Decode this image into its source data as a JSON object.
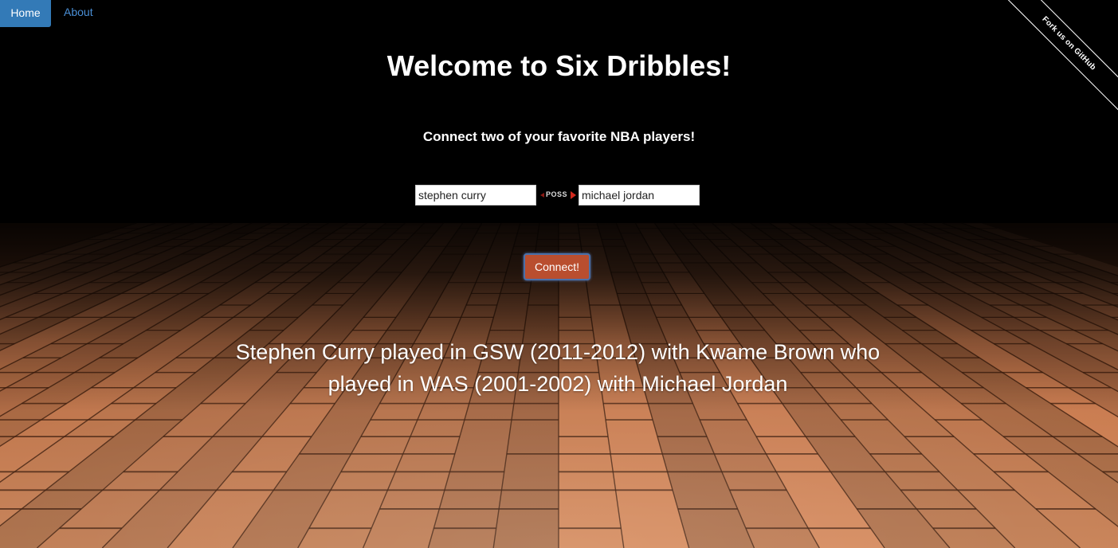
{
  "nav": {
    "home_label": "Home",
    "about_label": "About"
  },
  "ribbon": {
    "label": "Fork us on GitHub"
  },
  "main": {
    "title": "Welcome to Six Dribbles!",
    "subtitle": "Connect two of your favorite NBA players!",
    "player1_value": "stephen curry",
    "player2_value": "michael jordan",
    "poss_label": "POSS",
    "connect_label": "Connect!",
    "result": "Stephen Curry played in GSW (2011-2012) with Kwame Brown who played in WAS (2001-2002) with Michael Jordan"
  },
  "colors": {
    "nav_active": "#337ab7",
    "nav_link": "#4a8fd6",
    "button": "#b94e2f",
    "button_border": "#4a6fa8",
    "floor_light": "#c7875a",
    "floor_dark": "#7a3f22"
  },
  "icons": {
    "possession_indicator": "possession-arrow-icon"
  }
}
